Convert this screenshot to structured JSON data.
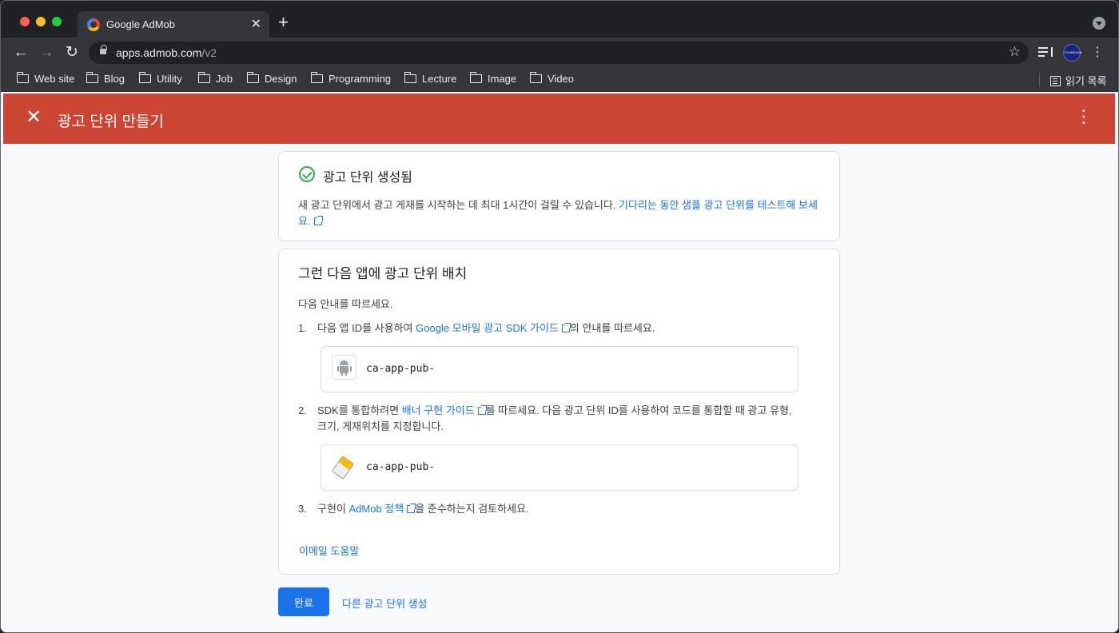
{
  "browser": {
    "tab_title": "Google AdMob",
    "tab_close": "✕",
    "new_tab": "+",
    "url_host": "apps.admob.com",
    "url_path": "/v2",
    "avatar_text": "YOUNGJUN",
    "bookmarks": [
      "Web site",
      "Blog",
      "Utility",
      "Job",
      "Design",
      "Programming",
      "Lecture",
      "Image",
      "Video"
    ],
    "reading_list": "읽기 목록",
    "icons": [
      "back-icon",
      "forward-icon",
      "reload-icon",
      "lock-icon",
      "star-icon",
      "media-icon",
      "folder-icon",
      "reading-list-icon"
    ]
  },
  "header": {
    "title": "광고 단위 만들기",
    "close_glyph": "✕",
    "more_glyph": "⋮",
    "bg_color": "#cc4433"
  },
  "card1": {
    "title": "광고 단위 생성됨",
    "text": "새 광고 단위에서 광고 게재를 시작하는 데 최대 1시간이 걸릴 수 있습니다. ",
    "link": "기다리는 동안 샘플 광고 단위를 테스트해 보세요."
  },
  "card2": {
    "title": "그런 다음 앱에 광고 단위 배치",
    "intro": "다음 안내를 따르세요.",
    "step1": {
      "num": "1.",
      "before": "다음 앱 ID를 사용하여 ",
      "link": "Google 모바일 광고 SDK 가이드",
      "after": "의 안내를 따르세요.",
      "id_value": "ca-app-pub-"
    },
    "step2": {
      "num": "2.",
      "before": "SDK를 통합하려면 ",
      "link": "배너 구현 가이드",
      "after": "를 따르세요. 다음 광고 단위 ID를 사용하여 코드를 통합할 때 광고 유형, 크기, 게재위치를 지정합니다.",
      "id_value": "ca-app-pub-"
    },
    "step3": {
      "num": "3.",
      "before": "구현이 ",
      "link": "AdMob 정책",
      "after": "을 준수하는지 검토하세요."
    },
    "email_help": "이메일 도움말"
  },
  "actions": {
    "done": "완료",
    "create_another": "다른 광고 단위 생성"
  },
  "colors": {
    "accent": "#1a73e8",
    "success": "#34a853"
  }
}
